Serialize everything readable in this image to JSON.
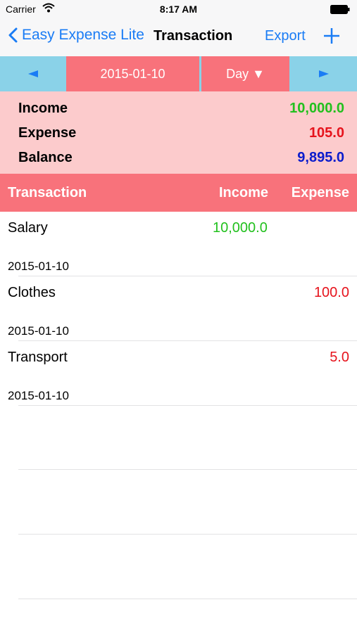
{
  "status": {
    "carrier": "Carrier",
    "time": "8:17 AM"
  },
  "nav": {
    "back_label": "Easy Expense Lite",
    "title": "Transaction",
    "export_label": "Export"
  },
  "filter": {
    "date": "2015-01-10",
    "period": "Day ▼"
  },
  "summary": {
    "income_label": "Income",
    "income_value": "10,000.0",
    "expense_label": "Expense",
    "expense_value": "105.0",
    "balance_label": "Balance",
    "balance_value": "9,895.0"
  },
  "table": {
    "headers": [
      "Transaction",
      "Income",
      "Expense"
    ],
    "rows": [
      {
        "name": "Salary",
        "income": "10,000.0",
        "expense": "",
        "date": "2015-01-10"
      },
      {
        "name": "Clothes",
        "income": "",
        "expense": "100.0",
        "date": "2015-01-10"
      },
      {
        "name": "Transport",
        "income": "",
        "expense": "5.0",
        "date": "2015-01-10"
      }
    ]
  },
  "colors": {
    "accent_blue": "#1a7cf5",
    "coral": "#f8727b",
    "pink": "#fccbcc",
    "sky": "#8ad2e8",
    "income_green": "#22c01e",
    "expense_red": "#e6131c",
    "balance_blue": "#0a1ccc"
  }
}
